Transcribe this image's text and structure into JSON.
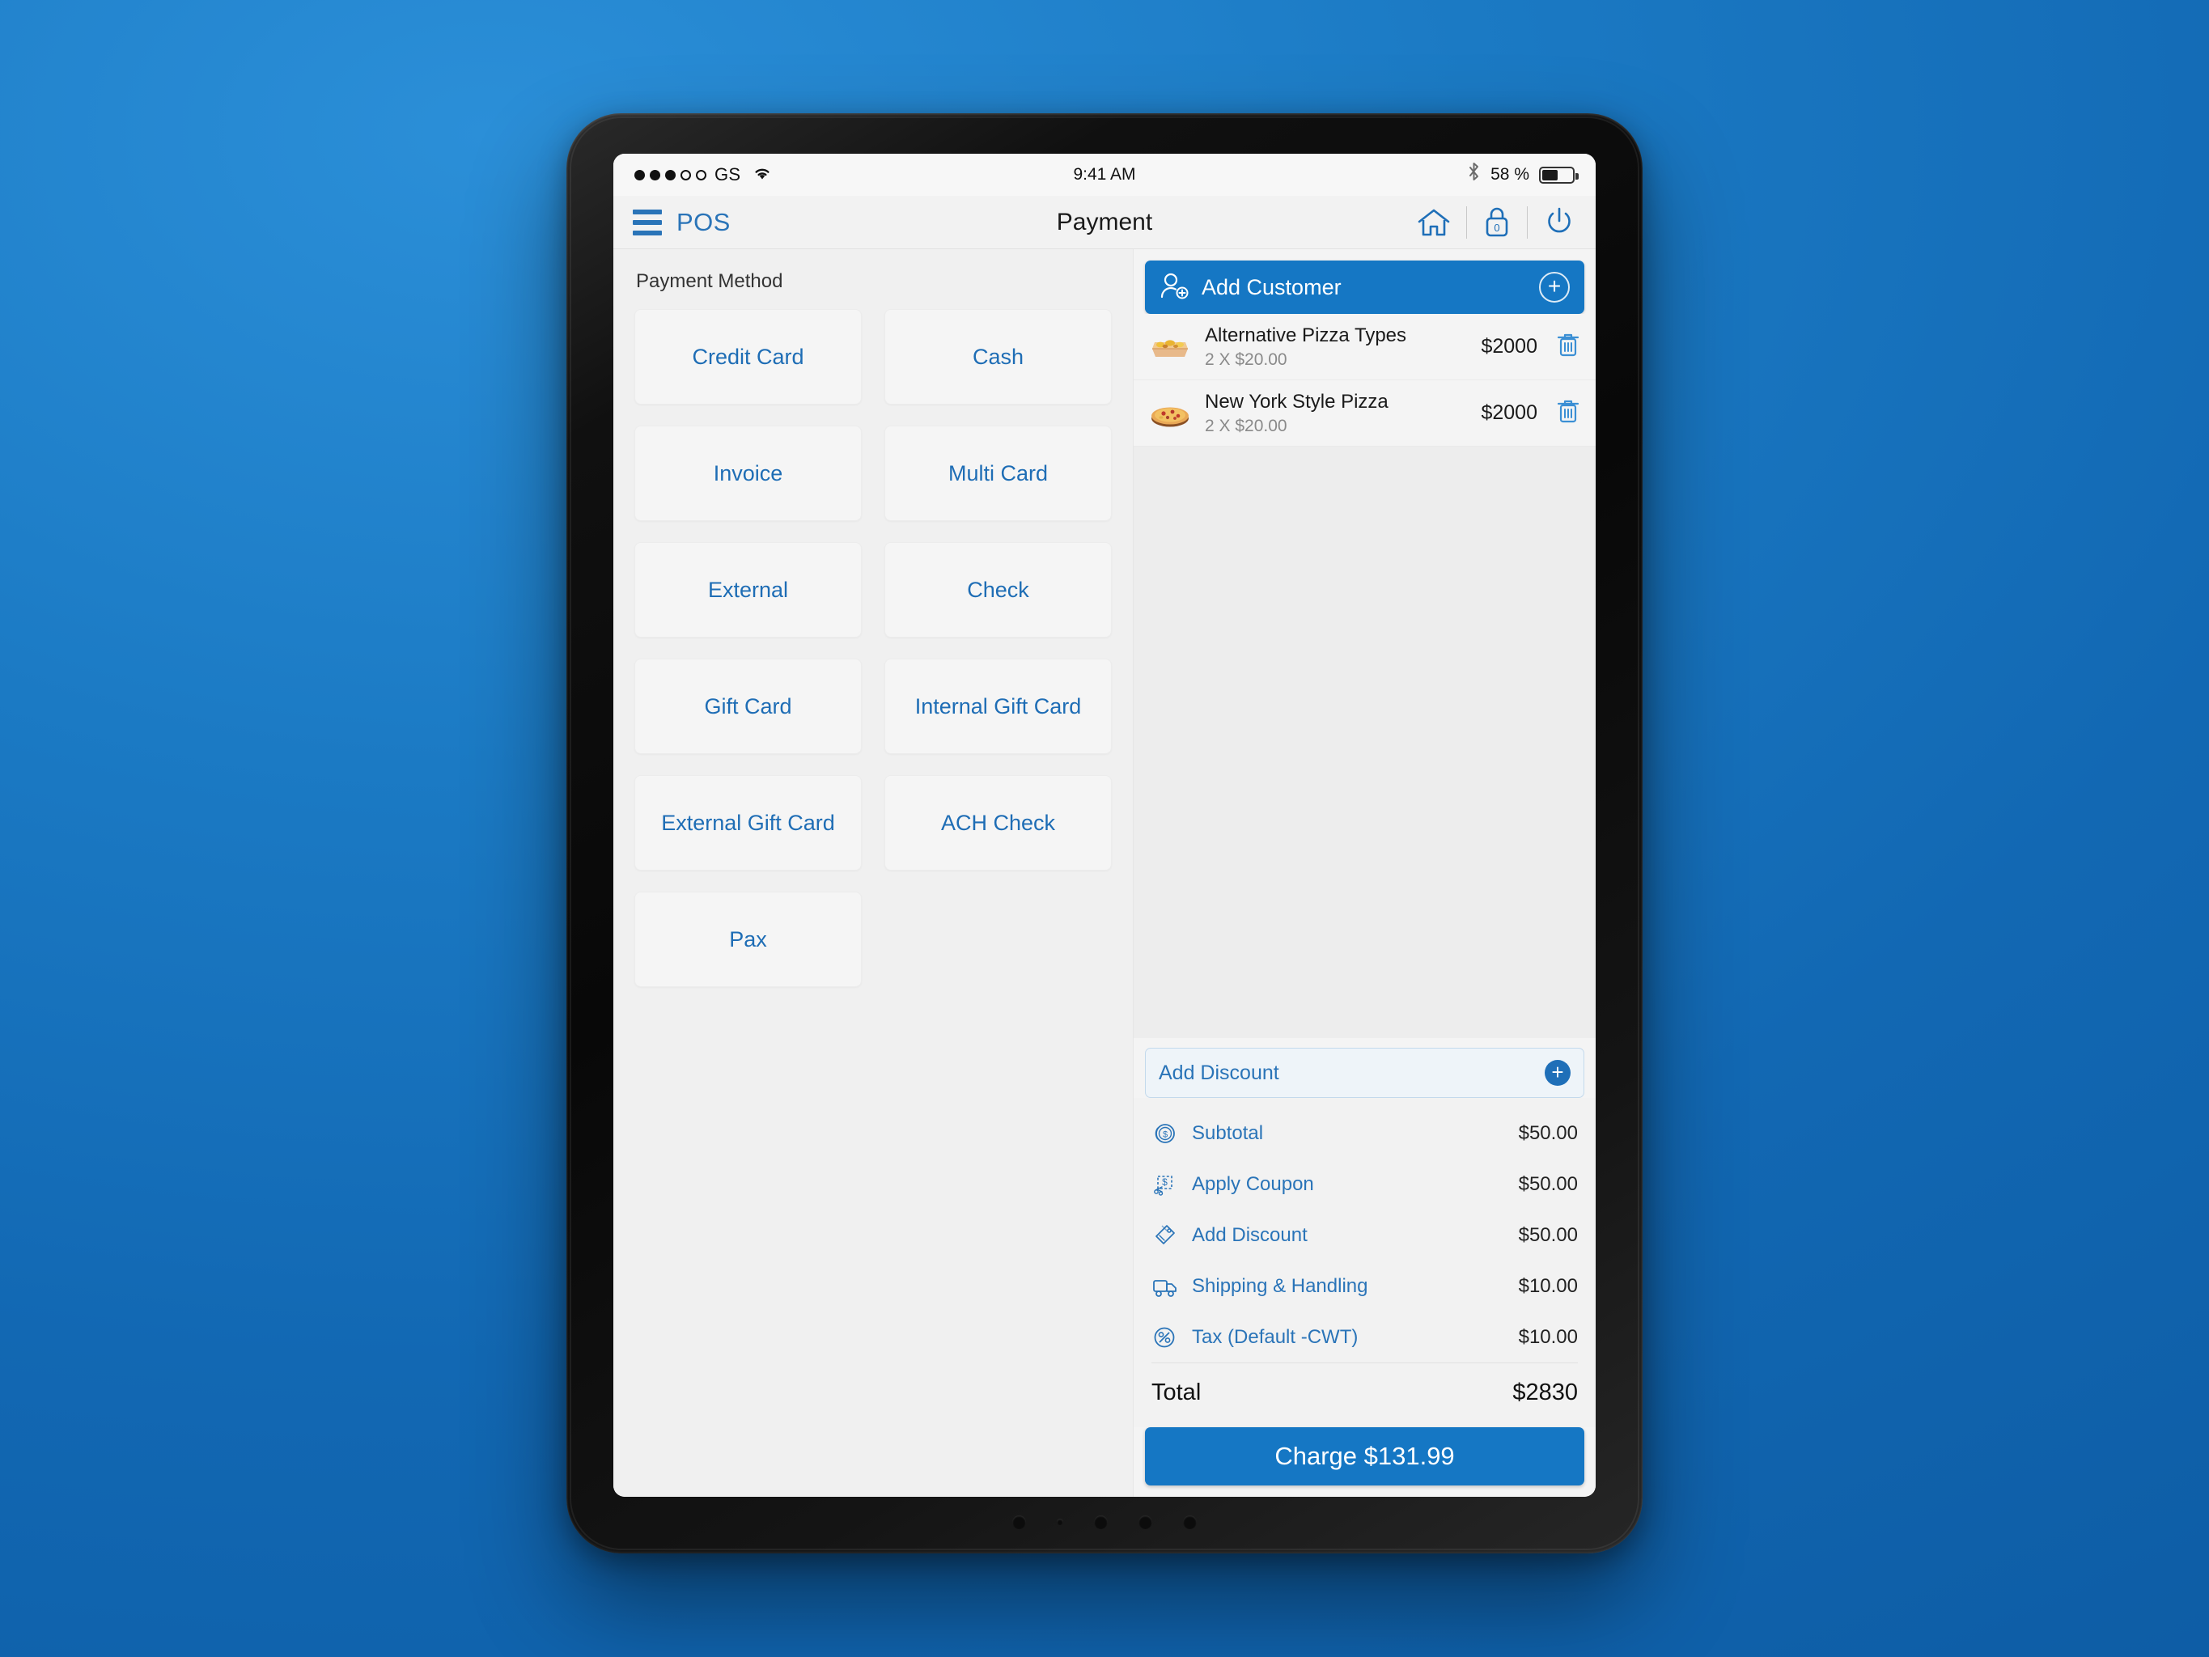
{
  "status_bar": {
    "signal_dots_filled": 3,
    "signal_dots_total": 5,
    "carrier": "GS",
    "wifi_icon": "wifi-icon",
    "time": "9:41 AM",
    "bluetooth_icon": "bluetooth-icon",
    "battery_percent": "58 %",
    "battery_level": 52
  },
  "header": {
    "menu_icon": "hamburger-menu-icon",
    "brand": "POS",
    "title": "Payment",
    "icons": [
      {
        "name": "home-icon"
      },
      {
        "name": "lock-icon",
        "badge": "0"
      },
      {
        "name": "power-icon"
      }
    ]
  },
  "payment_methods": {
    "title": "Payment Method",
    "buttons": [
      {
        "label": "Credit Card"
      },
      {
        "label": "Cash"
      },
      {
        "label": "Invoice"
      },
      {
        "label": "Multi Card"
      },
      {
        "label": "External"
      },
      {
        "label": "Check"
      },
      {
        "label": "Gift Card"
      },
      {
        "label": "Internal Gift Card"
      },
      {
        "label": "External Gift Card"
      },
      {
        "label": "ACH Check"
      },
      {
        "label": "Pax"
      }
    ]
  },
  "cart": {
    "add_customer": {
      "label": "Add Customer",
      "icon": "add-customer-icon",
      "plus_icon": "plus-circle-icon"
    },
    "items": [
      {
        "name": "Alternative Pizza Types",
        "qty_line": "2 X $20.00",
        "price": "$2000",
        "thumb": "pizza-slice-thumbnail",
        "delete_icon": "trash-icon"
      },
      {
        "name": "New York Style Pizza",
        "qty_line": "2 X $20.00",
        "price": "$2000",
        "thumb": "round-pizza-thumbnail",
        "delete_icon": "trash-icon"
      }
    ]
  },
  "discount_field": {
    "label": "Add Discount",
    "plus_icon": "plus-circle-filled-icon"
  },
  "summary": {
    "rows": [
      {
        "icon": "coin-dollar-icon",
        "label": "Subtotal",
        "value": "$50.00"
      },
      {
        "icon": "coupon-icon",
        "label": "Apply Coupon",
        "value": "$50.00"
      },
      {
        "icon": "price-tag-icon",
        "label": "Add Discount",
        "value": "$50.00"
      },
      {
        "icon": "truck-icon",
        "label": "Shipping & Handling",
        "value": "$10.00"
      },
      {
        "icon": "percent-circle-icon",
        "label": "Tax (Default -CWT)",
        "value": "$10.00"
      }
    ],
    "total_label": "Total",
    "total_value": "$2830"
  },
  "charge_button": {
    "label": "Charge $131.99"
  },
  "colors": {
    "accent": "#1577c4",
    "link": "#2a74b8",
    "panel_left": "#f0f0f0",
    "panel_right": "#f4f4f4"
  }
}
